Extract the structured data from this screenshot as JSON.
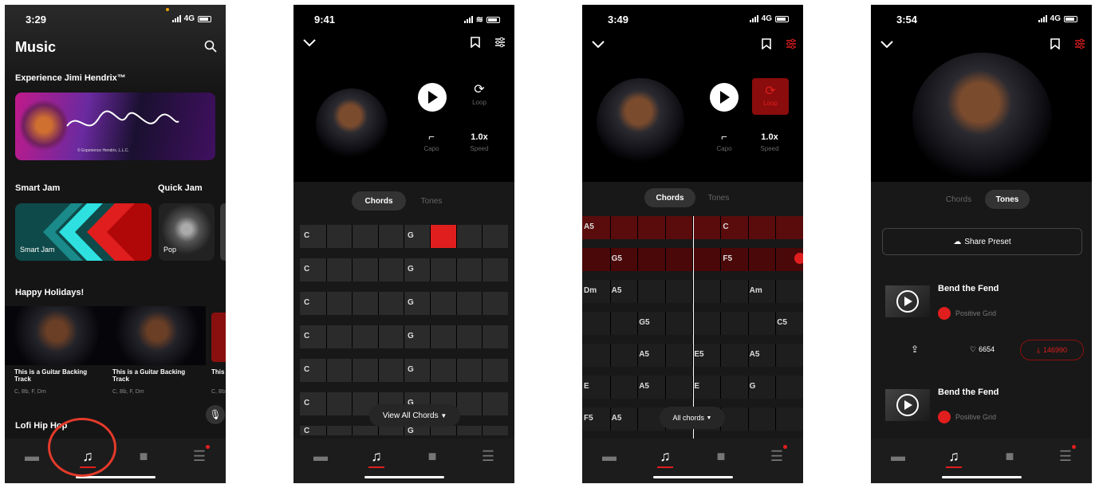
{
  "screens": [
    {
      "time": "3:29",
      "network": "4G",
      "title": "Music",
      "section_hendrix": "Experience Jimi Hendrix™",
      "banner_caption": "© Experience Hendrix, L.L.C.",
      "section_smartjam": "Smart Jam",
      "section_quickjam": "Quick Jam",
      "smartjam_card": "Smart Jam",
      "pop_card": "Pop",
      "section_holidays": "Happy Holidays!",
      "tracks": [
        {
          "title": "This is a Guitar Backing Track",
          "chords": "C, Bb, F, Dm"
        },
        {
          "title": "This is a Guitar Backing Track",
          "chords": "C, Bb, F, Dm"
        },
        {
          "title": "This is a Guitar Backing Track",
          "chords": "C, Bb"
        }
      ],
      "section_lofi": "Lofi Hip Hop"
    },
    {
      "time": "9:41",
      "loop_label": "Loop",
      "capo_label": "Capo",
      "speed_value": "1.0x",
      "speed_label": "Speed",
      "tab_chords": "Chords",
      "tab_tones": "Tones",
      "rows": [
        {
          "a": "C",
          "b": "G"
        },
        {
          "a": "C",
          "b": "G"
        },
        {
          "a": "C",
          "b": "G"
        },
        {
          "a": "C",
          "b": "G"
        },
        {
          "a": "C",
          "b": "G"
        },
        {
          "a": "C",
          "b": "G"
        },
        {
          "a": "C",
          "b": "G"
        }
      ],
      "view_all": "View All Chords"
    },
    {
      "time": "3:49",
      "network": "4G",
      "loop_label": "Loop",
      "capo_label": "Capo",
      "speed_value": "1.0x",
      "speed_label": "Speed",
      "tab_chords": "Chords",
      "tab_tones": "Tones",
      "all_chords": "All chords",
      "rows": [
        {
          "cells": [
            "A5",
            "",
            "",
            "",
            "C",
            "",
            "",
            ""
          ]
        },
        {
          "cells": [
            "",
            "G5",
            "",
            "",
            "F5",
            "",
            "",
            ""
          ]
        },
        {
          "cells": [
            "Dm",
            "A5",
            "",
            "",
            "",
            "",
            "Am",
            ""
          ]
        },
        {
          "cells": [
            "",
            "",
            "G5",
            "",
            "",
            "",
            "",
            "C5"
          ]
        },
        {
          "cells": [
            "",
            "",
            "A5",
            "",
            "E5",
            "",
            "A5",
            ""
          ]
        },
        {
          "cells": [
            "E",
            "",
            "A5",
            "",
            "E",
            "",
            "G",
            ""
          ]
        },
        {
          "cells": [
            "F5",
            "A5",
            "",
            "",
            "",
            "",
            "",
            ""
          ]
        }
      ]
    },
    {
      "time": "3:54",
      "network": "4G",
      "tab_chords": "Chords",
      "tab_tones": "Tones",
      "share_preset": "Share Preset",
      "presets": [
        {
          "name": "Bend the Fend",
          "author": "Positive Grid",
          "likes": "6654",
          "downloads": "146990"
        },
        {
          "name": "Bend the Fend",
          "author": "Positive Grid"
        }
      ]
    }
  ],
  "colors": {
    "accent": "#e01e1e",
    "bg": "#000000",
    "cell": "#2b2b2b"
  }
}
